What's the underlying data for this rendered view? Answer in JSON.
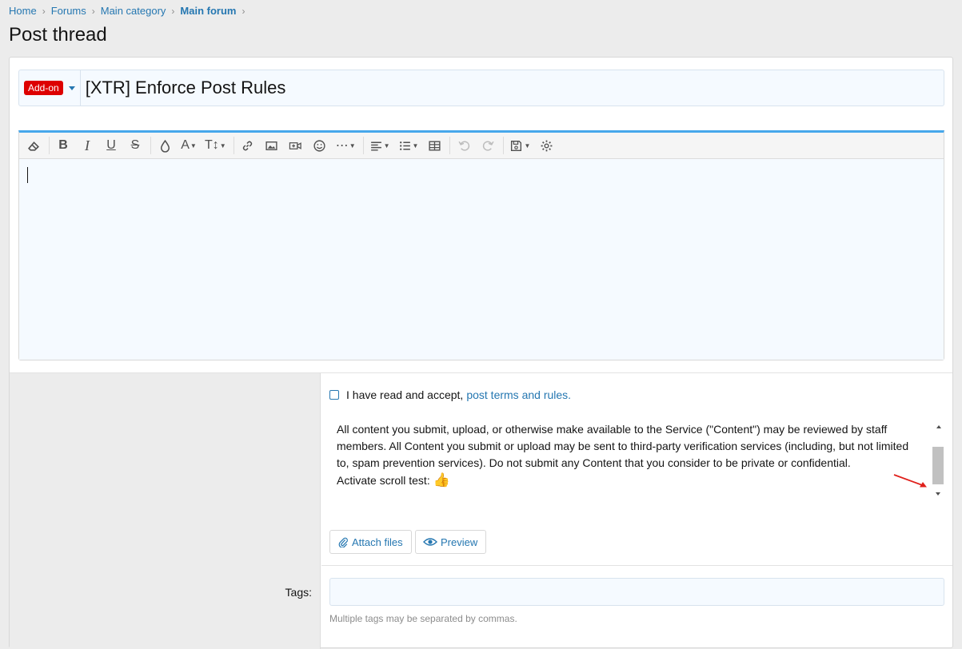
{
  "breadcrumb": {
    "items": [
      "Home",
      "Forums",
      "Main category",
      "Main forum"
    ]
  },
  "page": {
    "title": "Post thread"
  },
  "thread": {
    "prefix": "Add-on",
    "prefix_color": "#dd0000",
    "title_value": "[XTR] Enforce Post Rules"
  },
  "toolbar": {
    "icons": [
      "eraser-icon",
      "bold-icon",
      "italic-icon",
      "underline-icon",
      "strikethrough-icon",
      "color-drop-icon",
      "font-family-icon",
      "font-size-icon",
      "link-icon",
      "image-icon",
      "media-icon",
      "smilie-icon",
      "more-icon",
      "align-icon",
      "list-icon",
      "table-icon",
      "undo-icon",
      "redo-icon",
      "drafts-icon",
      "settings-icon"
    ],
    "glyphs": {
      "bold": "B",
      "italic": "I",
      "underline": "U",
      "strike": "S",
      "font": "A",
      "size": "T↕",
      "more": "⋯"
    }
  },
  "rules": {
    "accept_text": "I have read and accept,",
    "accept_link": "post terms and rules.",
    "body_lines": [
      "All content you submit, upload, or otherwise make available to the Service (\"Content\") may be reviewed by staff members. All Content you submit or upload may be sent to third-party verification services (including, but not limited to, spam prevention services). Do not submit any Content that you consider to be private or confidential.",
      "Activate scroll test:"
    ],
    "emoji": "👍"
  },
  "actions": {
    "attach_label": "Attach files",
    "preview_label": "Preview"
  },
  "tags": {
    "label": "Tags:",
    "value": "",
    "hint": "Multiple tags may be separated by commas."
  },
  "colors": {
    "link": "#2577b1",
    "editor_top_border": "#47a7eb",
    "annotation_arrow": "#e0201b"
  }
}
